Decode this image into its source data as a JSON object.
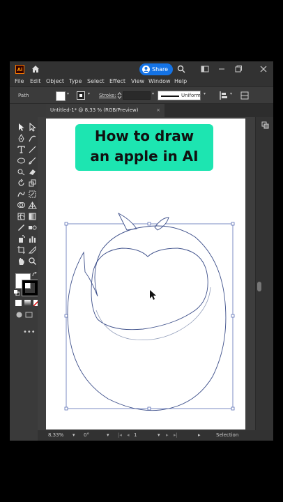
{
  "app": {
    "logo_text": "Ai",
    "share_label": "Share",
    "accent_color": "#1473e6"
  },
  "menu": [
    "File",
    "Edit",
    "Object",
    "Type",
    "Select",
    "Effect",
    "View",
    "Window",
    "Help"
  ],
  "control_bar": {
    "selection_type": "Path",
    "stroke_label": "Stroke:",
    "stroke_profile": "Uniform"
  },
  "document_tab": {
    "title": "Untitled-1* @ 8,33 % (RGB/Preview)",
    "close": "×"
  },
  "overlay": {
    "line1": "How to draw",
    "line2": "an apple in AI",
    "bg_color": "#1de5b1"
  },
  "status_bar": {
    "zoom": "8,33%",
    "rotation": "0°",
    "artboard_number": "1",
    "tool_name": "Selection"
  }
}
